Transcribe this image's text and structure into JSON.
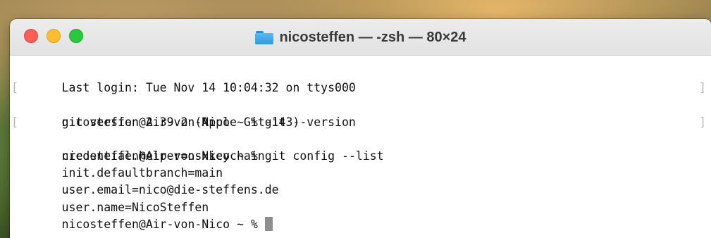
{
  "window": {
    "title": "nicosteffen — -zsh — 80×24",
    "title_icon": "folder-icon",
    "traffic_lights": {
      "close_color": "#ff5f57",
      "minimize_color": "#febc2e",
      "maximize_color": "#28c840"
    }
  },
  "terminal": {
    "lines": [
      {
        "text": "Last login: Tue Nov 14 10:04:32 on ttys000",
        "marked": false
      },
      {
        "text": "nicosteffen@Air-von-Nico ~ % git --version",
        "marked": true
      },
      {
        "text": "git version 2.39.2 (Apple Git-143)",
        "marked": false
      },
      {
        "text": "nicosteffen@Air-von-Nico ~ % git config --list",
        "marked": true
      },
      {
        "text": "credential.helper=osxkeychain",
        "marked": false
      },
      {
        "text": "init.defaultbranch=main",
        "marked": false
      },
      {
        "text": "user.email=nico@die-steffens.de",
        "marked": false
      },
      {
        "text": "user.name=NicoSteffen",
        "marked": false
      }
    ],
    "prompt": "nicosteffen@Air-von-Nico ~ % ",
    "mark_left": "[",
    "mark_right": "]"
  }
}
